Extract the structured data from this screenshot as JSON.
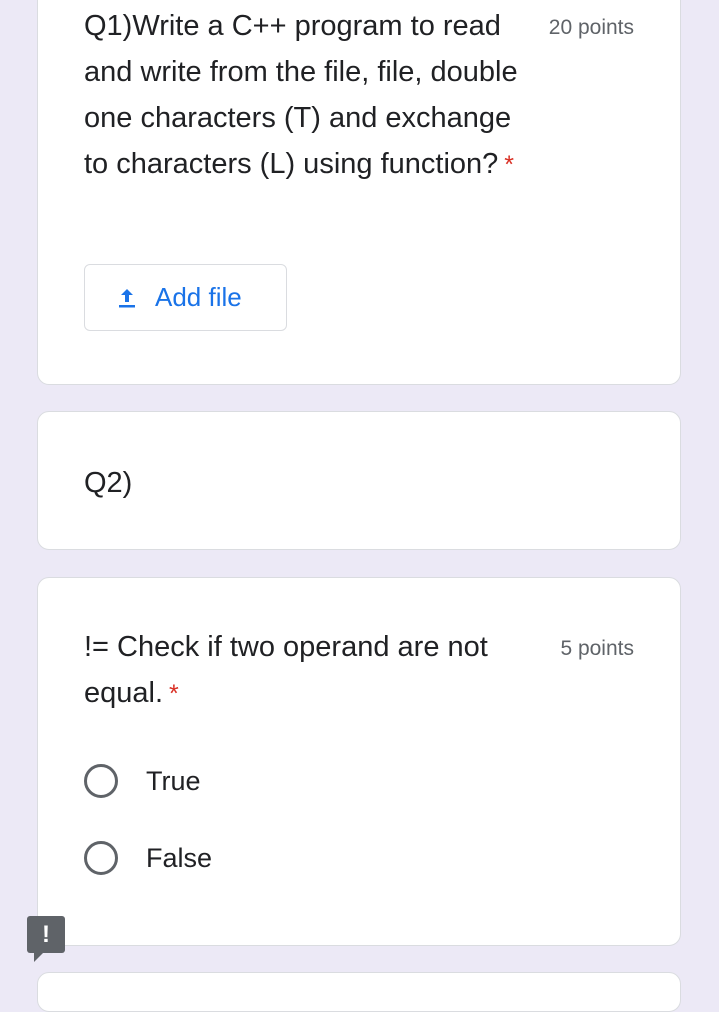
{
  "questions": [
    {
      "title": "Q1)Write a C++ program to read and write from the file, file, double one characters (T) and exchange to characters (L) using function?",
      "required_mark": "*",
      "points": "20 points",
      "add_file_label": "Add file"
    },
    {
      "title": "Q2)"
    },
    {
      "title": "!= Check if two operand are not equal.",
      "required_mark": "*",
      "points": "5 points",
      "options": [
        "True",
        "False"
      ]
    }
  ],
  "report_button_icon": "!",
  "colors": {
    "background": "#ece9f6",
    "card": "#ffffff",
    "accent": "#1a73e8",
    "required": "#d93025",
    "secondary_text": "#5f6368"
  },
  "icons": {
    "upload": "upload-icon",
    "report": "report-problem-icon"
  }
}
